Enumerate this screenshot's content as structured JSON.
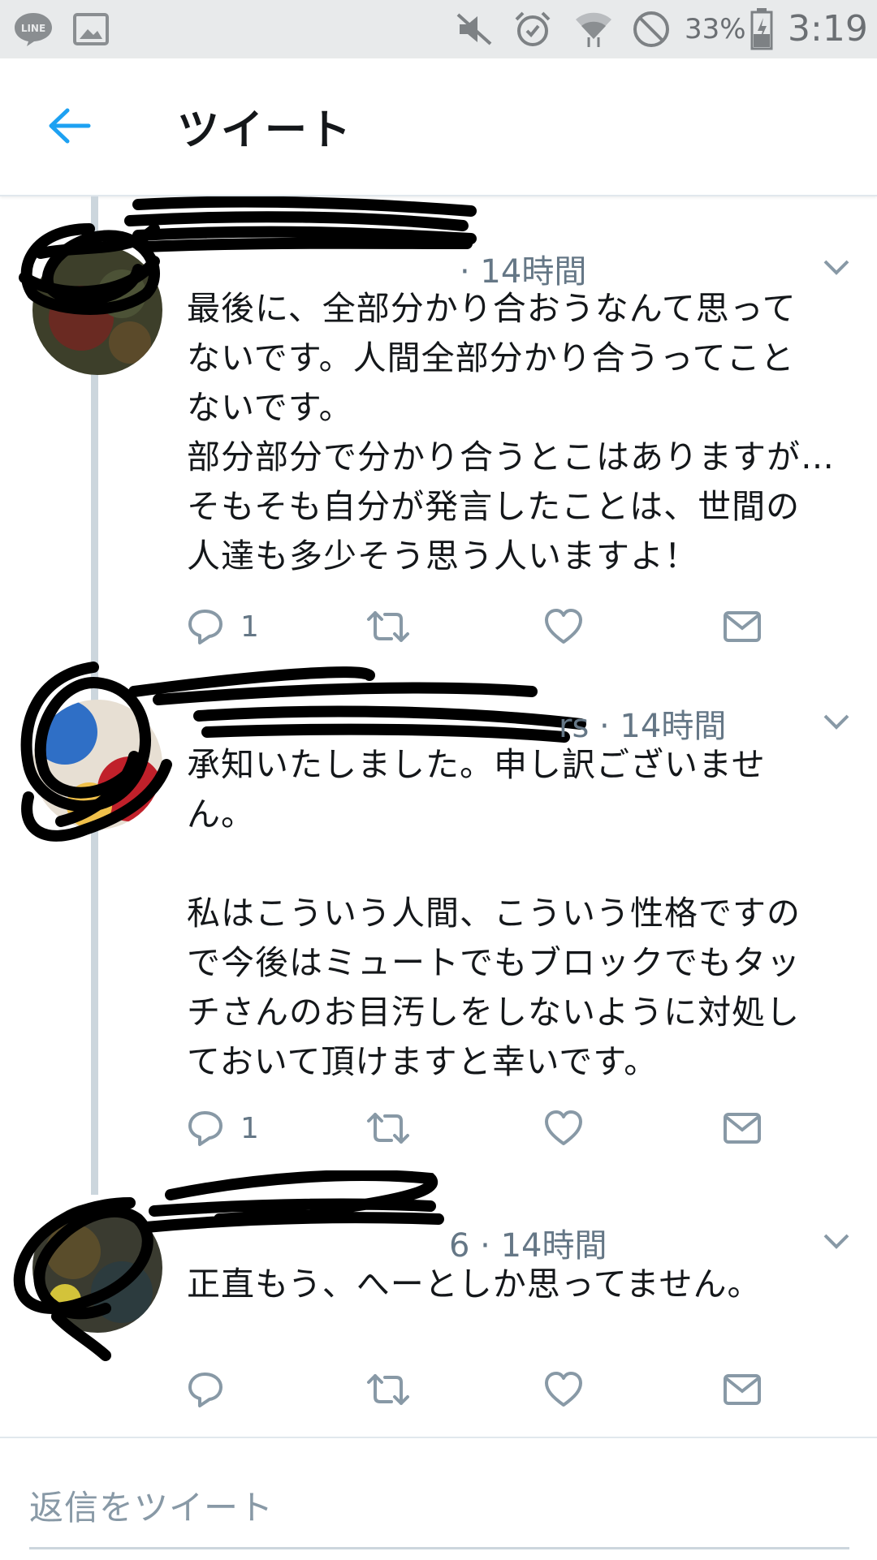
{
  "status_bar": {
    "icons": [
      "line-icon",
      "gallery-icon",
      "mute-icon",
      "alarm-icon",
      "wifi-icon",
      "do-not-disturb-icon",
      "battery-icon"
    ],
    "battery": "33%",
    "time": "3:19"
  },
  "header": {
    "back_icon": "arrow-left-icon",
    "title": "ツイート"
  },
  "tweets": [
    {
      "meta_visible": "· 14時間",
      "lines": [
        "最後に、全部分かり合おうなんて思って",
        "ないです。人間全部分かり合うってこと",
        "ないです。",
        "部分部分で分かり合うとこはありますが…",
        "そもそも自分が発言したことは、世間の",
        "人達も多少そう思う人いますよ！"
      ],
      "reply_count": "1"
    },
    {
      "meta_visible": "rs · 14時間",
      "lines": [
        "承知いたしました。申し訳ございませ",
        "ん。",
        "",
        "私はこういう人間、こういう性格ですの",
        "で今後はミュートでもブロックでもタッ",
        "チさんのお目汚しをしないように対処し",
        "ておいて頂けますと幸いです。"
      ],
      "reply_count": "1"
    },
    {
      "meta_visible": "6 · 14時間",
      "lines": [
        "正直もう、へーとしか思ってません。"
      ],
      "reply_count": ""
    }
  ],
  "action_icons": [
    "reply-icon",
    "retweet-icon",
    "like-icon",
    "dm-icon"
  ],
  "reply": {
    "placeholder": "返信をツイート"
  },
  "colors": {
    "accent": "#1da1f2",
    "text": "#14171a",
    "muted": "#657786",
    "thread_line": "#ccd6dd",
    "status_bar": "#e8eaeb"
  }
}
